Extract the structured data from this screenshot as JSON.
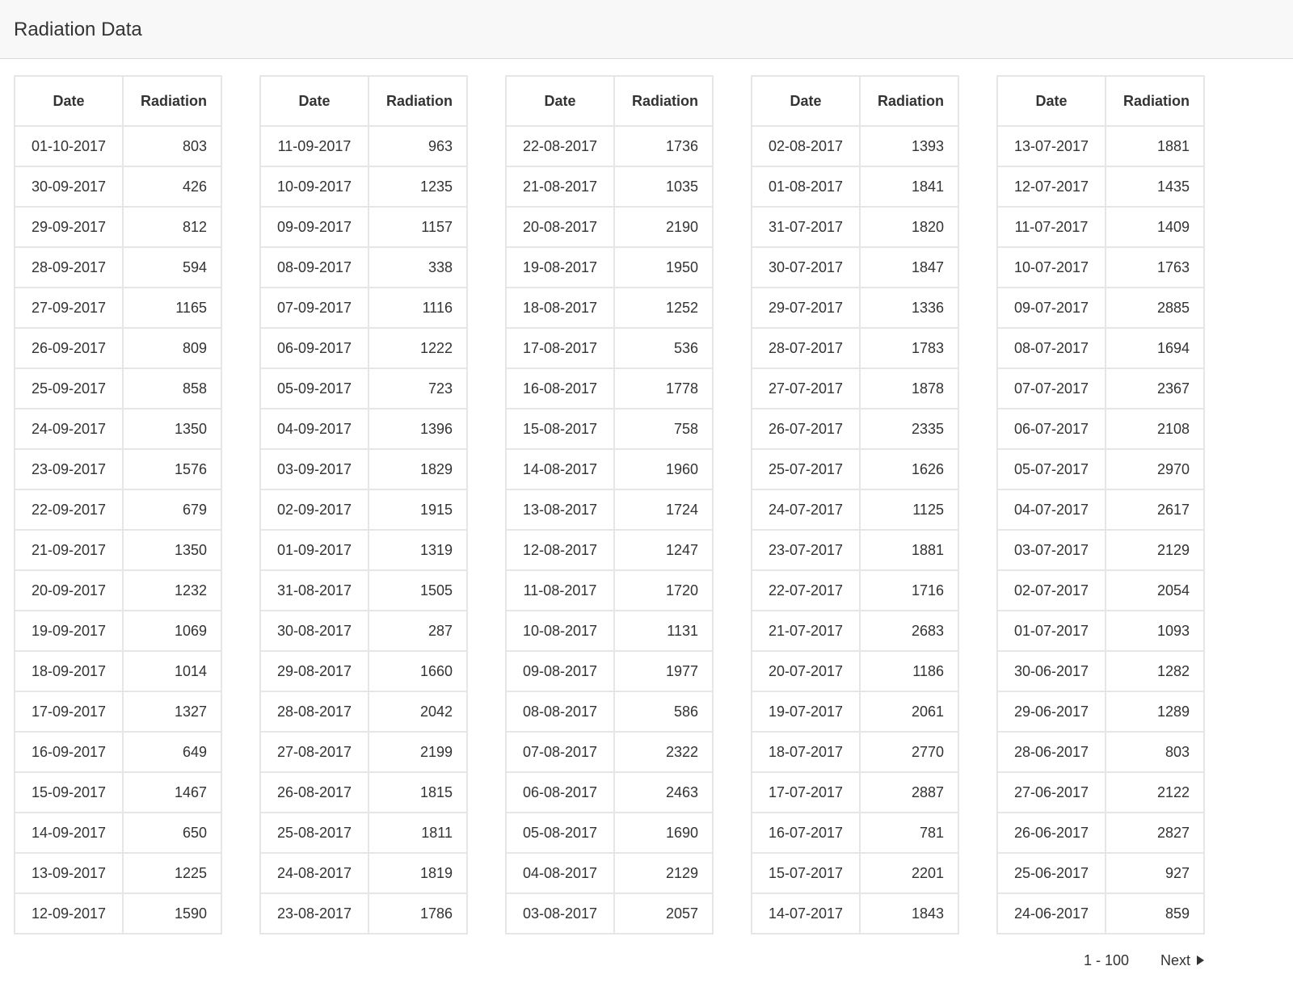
{
  "header": {
    "title": "Radiation Data"
  },
  "table_columns": {
    "date": "Date",
    "radiation": "Radiation"
  },
  "tables": [
    {
      "rows": [
        [
          "01-10-2017",
          "803"
        ],
        [
          "30-09-2017",
          "426"
        ],
        [
          "29-09-2017",
          "812"
        ],
        [
          "28-09-2017",
          "594"
        ],
        [
          "27-09-2017",
          "1165"
        ],
        [
          "26-09-2017",
          "809"
        ],
        [
          "25-09-2017",
          "858"
        ],
        [
          "24-09-2017",
          "1350"
        ],
        [
          "23-09-2017",
          "1576"
        ],
        [
          "22-09-2017",
          "679"
        ],
        [
          "21-09-2017",
          "1350"
        ],
        [
          "20-09-2017",
          "1232"
        ],
        [
          "19-09-2017",
          "1069"
        ],
        [
          "18-09-2017",
          "1014"
        ],
        [
          "17-09-2017",
          "1327"
        ],
        [
          "16-09-2017",
          "649"
        ],
        [
          "15-09-2017",
          "1467"
        ],
        [
          "14-09-2017",
          "650"
        ],
        [
          "13-09-2017",
          "1225"
        ],
        [
          "12-09-2017",
          "1590"
        ]
      ]
    },
    {
      "rows": [
        [
          "11-09-2017",
          "963"
        ],
        [
          "10-09-2017",
          "1235"
        ],
        [
          "09-09-2017",
          "1157"
        ],
        [
          "08-09-2017",
          "338"
        ],
        [
          "07-09-2017",
          "1116"
        ],
        [
          "06-09-2017",
          "1222"
        ],
        [
          "05-09-2017",
          "723"
        ],
        [
          "04-09-2017",
          "1396"
        ],
        [
          "03-09-2017",
          "1829"
        ],
        [
          "02-09-2017",
          "1915"
        ],
        [
          "01-09-2017",
          "1319"
        ],
        [
          "31-08-2017",
          "1505"
        ],
        [
          "30-08-2017",
          "287"
        ],
        [
          "29-08-2017",
          "1660"
        ],
        [
          "28-08-2017",
          "2042"
        ],
        [
          "27-08-2017",
          "2199"
        ],
        [
          "26-08-2017",
          "1815"
        ],
        [
          "25-08-2017",
          "1811"
        ],
        [
          "24-08-2017",
          "1819"
        ],
        [
          "23-08-2017",
          "1786"
        ]
      ]
    },
    {
      "rows": [
        [
          "22-08-2017",
          "1736"
        ],
        [
          "21-08-2017",
          "1035"
        ],
        [
          "20-08-2017",
          "2190"
        ],
        [
          "19-08-2017",
          "1950"
        ],
        [
          "18-08-2017",
          "1252"
        ],
        [
          "17-08-2017",
          "536"
        ],
        [
          "16-08-2017",
          "1778"
        ],
        [
          "15-08-2017",
          "758"
        ],
        [
          "14-08-2017",
          "1960"
        ],
        [
          "13-08-2017",
          "1724"
        ],
        [
          "12-08-2017",
          "1247"
        ],
        [
          "11-08-2017",
          "1720"
        ],
        [
          "10-08-2017",
          "1131"
        ],
        [
          "09-08-2017",
          "1977"
        ],
        [
          "08-08-2017",
          "586"
        ],
        [
          "07-08-2017",
          "2322"
        ],
        [
          "06-08-2017",
          "2463"
        ],
        [
          "05-08-2017",
          "1690"
        ],
        [
          "04-08-2017",
          "2129"
        ],
        [
          "03-08-2017",
          "2057"
        ]
      ]
    },
    {
      "rows": [
        [
          "02-08-2017",
          "1393"
        ],
        [
          "01-08-2017",
          "1841"
        ],
        [
          "31-07-2017",
          "1820"
        ],
        [
          "30-07-2017",
          "1847"
        ],
        [
          "29-07-2017",
          "1336"
        ],
        [
          "28-07-2017",
          "1783"
        ],
        [
          "27-07-2017",
          "1878"
        ],
        [
          "26-07-2017",
          "2335"
        ],
        [
          "25-07-2017",
          "1626"
        ],
        [
          "24-07-2017",
          "1125"
        ],
        [
          "23-07-2017",
          "1881"
        ],
        [
          "22-07-2017",
          "1716"
        ],
        [
          "21-07-2017",
          "2683"
        ],
        [
          "20-07-2017",
          "1186"
        ],
        [
          "19-07-2017",
          "2061"
        ],
        [
          "18-07-2017",
          "2770"
        ],
        [
          "17-07-2017",
          "2887"
        ],
        [
          "16-07-2017",
          "781"
        ],
        [
          "15-07-2017",
          "2201"
        ],
        [
          "14-07-2017",
          "1843"
        ]
      ]
    },
    {
      "rows": [
        [
          "13-07-2017",
          "1881"
        ],
        [
          "12-07-2017",
          "1435"
        ],
        [
          "11-07-2017",
          "1409"
        ],
        [
          "10-07-2017",
          "1763"
        ],
        [
          "09-07-2017",
          "2885"
        ],
        [
          "08-07-2017",
          "1694"
        ],
        [
          "07-07-2017",
          "2367"
        ],
        [
          "06-07-2017",
          "2108"
        ],
        [
          "05-07-2017",
          "2970"
        ],
        [
          "04-07-2017",
          "2617"
        ],
        [
          "03-07-2017",
          "2129"
        ],
        [
          "02-07-2017",
          "2054"
        ],
        [
          "01-07-2017",
          "1093"
        ],
        [
          "30-06-2017",
          "1282"
        ],
        [
          "29-06-2017",
          "1289"
        ],
        [
          "28-06-2017",
          "803"
        ],
        [
          "27-06-2017",
          "2122"
        ],
        [
          "26-06-2017",
          "2827"
        ],
        [
          "25-06-2017",
          "927"
        ],
        [
          "24-06-2017",
          "859"
        ]
      ]
    }
  ],
  "pagination": {
    "range": "1 - 100",
    "next_label": "Next",
    "next_icon": "triangle-right-icon"
  }
}
